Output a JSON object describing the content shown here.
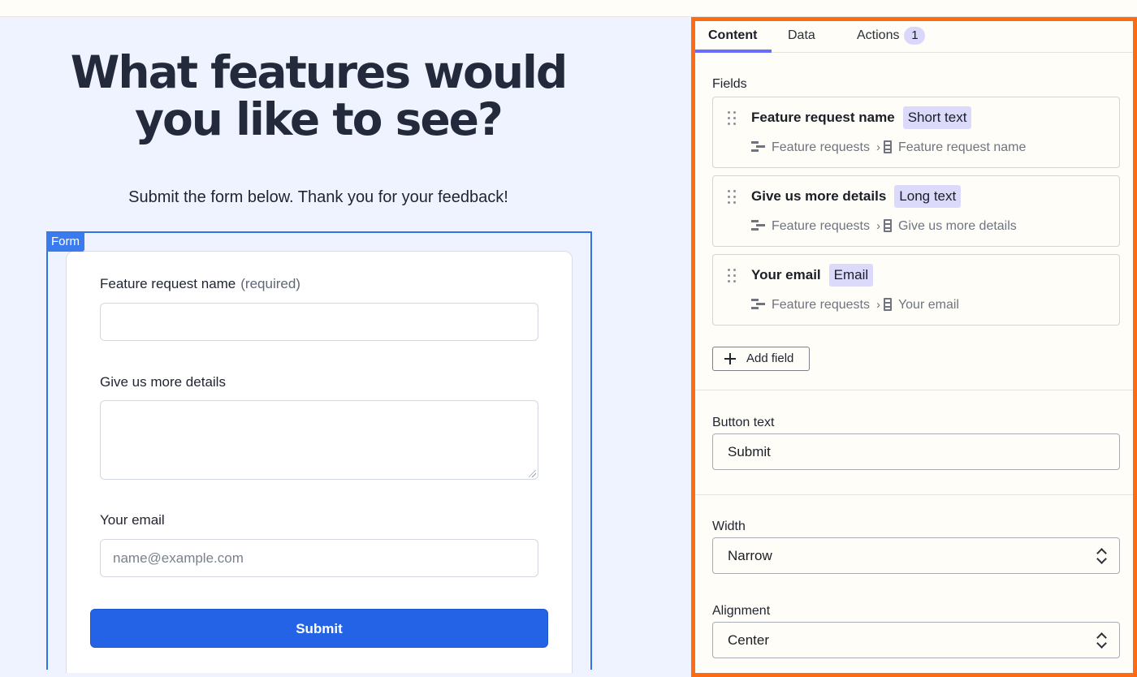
{
  "canvas": {
    "headline": "What features would you like to see?",
    "subtitle": "Submit the form below. Thank you for your feedback!",
    "form_tag": "Form",
    "fields": [
      {
        "label": "Feature request name",
        "note": "(required)",
        "value": ""
      },
      {
        "label": "Give us more details",
        "value": ""
      },
      {
        "label": "Your email",
        "placeholder": "name@example.com"
      }
    ],
    "submit_label": "Submit"
  },
  "panel": {
    "tabs": [
      {
        "label": "Content",
        "active": true
      },
      {
        "label": "Data"
      },
      {
        "label": "Actions",
        "badge": "1"
      }
    ],
    "fields_heading": "Fields",
    "field_cards": [
      {
        "name": "Feature request name",
        "type": "Short text",
        "table": "Feature requests",
        "column": "Feature request name"
      },
      {
        "name": "Give us more details",
        "type": "Long text",
        "table": "Feature requests",
        "column": "Give us more details"
      },
      {
        "name": "Your email",
        "type": "Email",
        "table": "Feature requests",
        "column": "Your email"
      }
    ],
    "add_field_label": "Add field",
    "button_text_label": "Button text",
    "button_text_value": "Submit",
    "width_label": "Width",
    "width_value": "Narrow",
    "alignment_label": "Alignment",
    "alignment_value": "Center"
  },
  "colors": {
    "accent": "#ff6a13",
    "primary_button": "#2563e6",
    "tab_underline": "#6b6cff",
    "type_chip": "#dcdafb"
  },
  "icons": [
    "drag-handle-icon",
    "table-icon",
    "chevron-right-icon",
    "column-icon",
    "plus-icon",
    "select-arrows-icon"
  ]
}
